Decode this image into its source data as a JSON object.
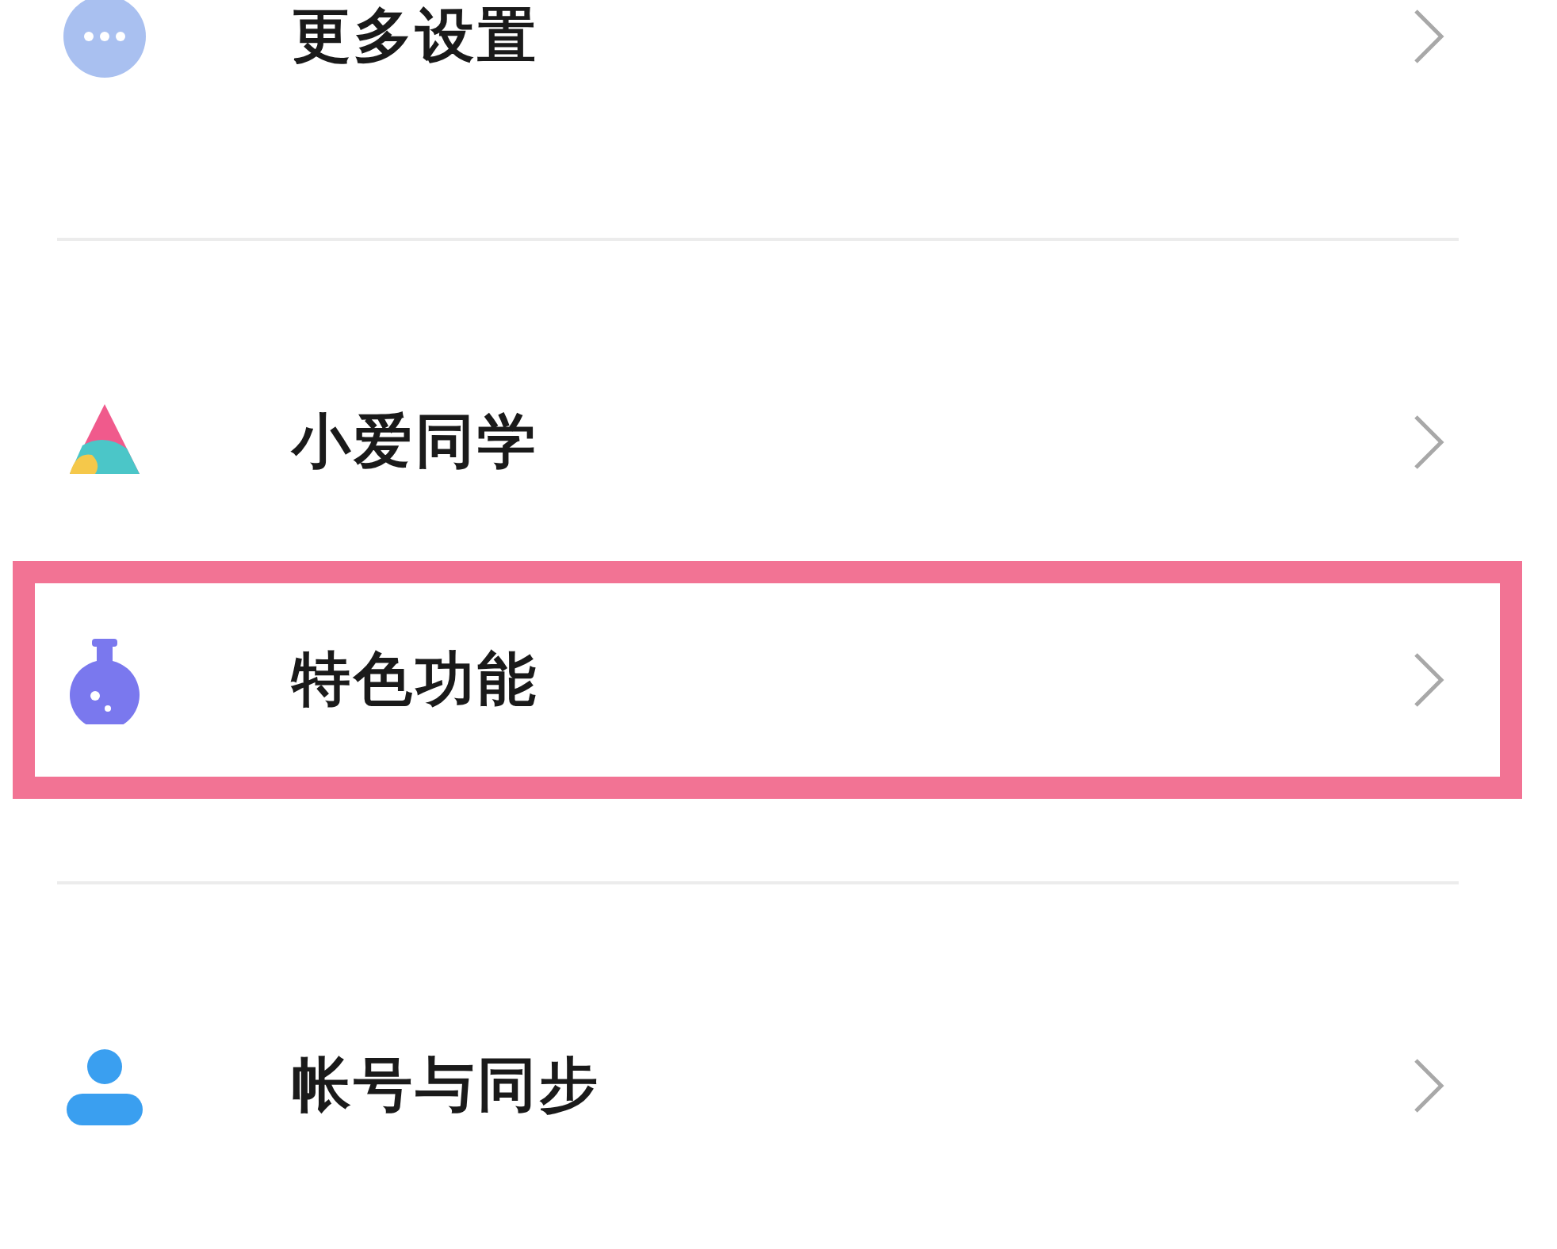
{
  "groups": [
    {
      "items": [
        {
          "label": "更多设置",
          "kind": "more",
          "highlighted": false
        }
      ]
    },
    {
      "items": [
        {
          "label": "小爱同学",
          "kind": "assistant",
          "highlighted": false
        },
        {
          "label": "特色功能",
          "kind": "flask",
          "highlighted": true
        }
      ]
    },
    {
      "items": [
        {
          "label": "帐号与同步",
          "kind": "person",
          "highlighted": false
        }
      ]
    }
  ]
}
